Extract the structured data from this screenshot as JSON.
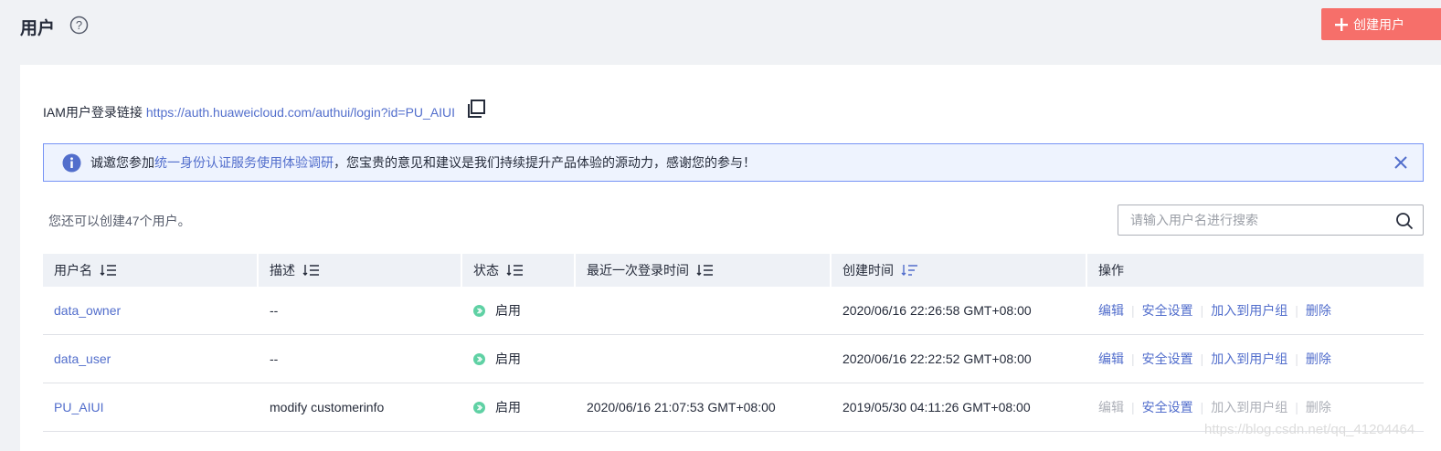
{
  "header": {
    "title": "用户",
    "create_button": "创建用户"
  },
  "login": {
    "label": "IAM用户登录链接",
    "url": "https://auth.huaweicloud.com/authui/login?id=PU_AIUI"
  },
  "notice": {
    "prefix": "诚邀您参加",
    "link": "统一身份认证服务使用体验调研",
    "suffix": "，您宝贵的意见和建议是我们持续提升产品体验的源动力，感谢您的参与！"
  },
  "quota": "您还可以创建47个用户。",
  "search": {
    "placeholder": "请输入用户名进行搜索"
  },
  "table": {
    "columns": [
      "用户名",
      "描述",
      "状态",
      "最近一次登录时间",
      "创建时间",
      "操作"
    ],
    "rows": [
      {
        "username": "data_owner",
        "description": "--",
        "status": "启用",
        "last_login": "",
        "created": "2020/06/16 22:26:58 GMT+08:00",
        "ops": [
          "编辑",
          "安全设置",
          "加入到用户组",
          "删除"
        ]
      },
      {
        "username": "data_user",
        "description": "--",
        "status": "启用",
        "last_login": "",
        "created": "2020/06/16 22:22:52 GMT+08:00",
        "ops": [
          "编辑",
          "安全设置",
          "加入到用户组",
          "删除"
        ]
      },
      {
        "username": "PU_AIUI",
        "description": "modify customerinfo",
        "status": "启用",
        "last_login": "2020/06/16 21:07:53 GMT+08:00",
        "created": "2019/05/30 04:11:26 GMT+08:00",
        "ops": [
          "编辑",
          "安全设置",
          "加入到用户组",
          "删除"
        ]
      }
    ]
  },
  "watermark": "https://blog.csdn.net/qq_41204464",
  "colors": {
    "accent": "#526ecc",
    "danger": "#f66f6a",
    "status_ok": "#5fd1a4"
  }
}
